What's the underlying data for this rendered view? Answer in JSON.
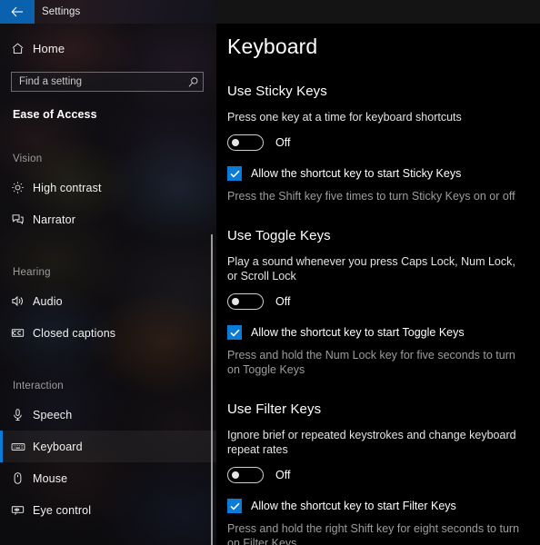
{
  "titlebar": {
    "back_icon": "back-arrow-icon",
    "title": "Settings"
  },
  "sidebar": {
    "home": {
      "label": "Home",
      "icon": "home-icon"
    },
    "search": {
      "placeholder": "Find a setting",
      "value": "",
      "icon": "search-icon"
    },
    "group_title": "Ease of Access",
    "sections": [
      {
        "label": "Vision",
        "items": [
          {
            "label": "High contrast",
            "icon": "brightness-icon",
            "selected": false
          },
          {
            "label": "Narrator",
            "icon": "narrator-icon",
            "selected": false
          }
        ]
      },
      {
        "label": "Hearing",
        "items": [
          {
            "label": "Audio",
            "icon": "speaker-icon",
            "selected": false
          },
          {
            "label": "Closed captions",
            "icon": "closed-captions-icon",
            "selected": false
          }
        ]
      },
      {
        "label": "Interaction",
        "items": [
          {
            "label": "Speech",
            "icon": "microphone-icon",
            "selected": false
          },
          {
            "label": "Keyboard",
            "icon": "keyboard-icon",
            "selected": true
          },
          {
            "label": "Mouse",
            "icon": "mouse-icon",
            "selected": false
          },
          {
            "label": "Eye control",
            "icon": "eye-control-icon",
            "selected": false
          }
        ]
      }
    ]
  },
  "content": {
    "page_title": "Keyboard",
    "sections": [
      {
        "heading": "Use Sticky Keys",
        "description": "Press one key at a time for keyboard shortcuts",
        "toggle_state": "Off",
        "toggle_on": false,
        "checkbox_label": "Allow the shortcut key to start Sticky Keys",
        "checkbox_checked": true,
        "hint": "Press the Shift key five times to turn Sticky Keys on or off"
      },
      {
        "heading": "Use Toggle Keys",
        "description": "Play a sound whenever you press Caps Lock, Num Lock, or Scroll Lock",
        "toggle_state": "Off",
        "toggle_on": false,
        "checkbox_label": "Allow the shortcut key to start Toggle Keys",
        "checkbox_checked": true,
        "hint": "Press and hold the Num Lock key for five seconds to turn on Toggle Keys"
      },
      {
        "heading": "Use Filter Keys",
        "description": "Ignore brief or repeated keystrokes and change keyboard repeat rates",
        "toggle_state": "Off",
        "toggle_on": false,
        "checkbox_label": "Allow the shortcut key to start Filter Keys",
        "checkbox_checked": true,
        "hint": "Press and hold the right Shift key for eight seconds to turn on Filter Keys"
      }
    ]
  },
  "colors": {
    "accent": "#0a7bd6",
    "back_button": "#0a62ae",
    "content_bg": "#000000",
    "muted_text": "#9d9d9d"
  }
}
